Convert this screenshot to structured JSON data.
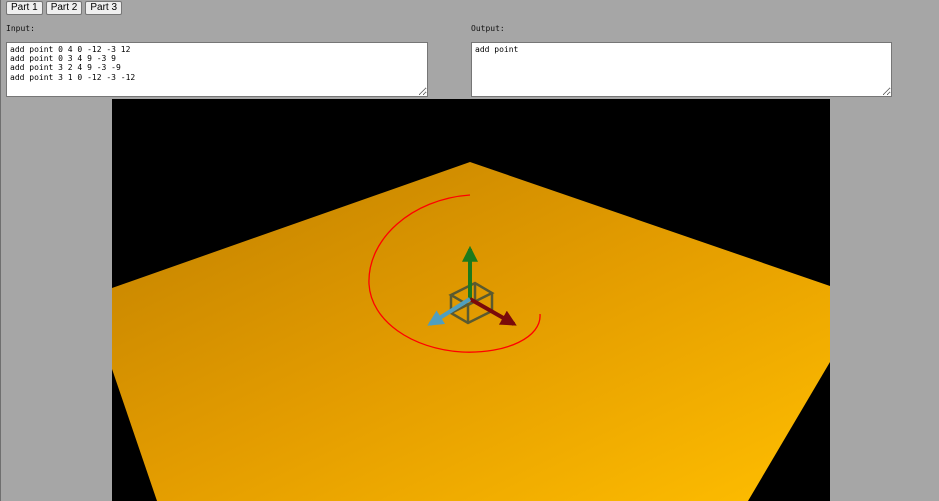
{
  "tabs": [
    "Part 1",
    "Part 2",
    "Part 3"
  ],
  "input": {
    "label": "Input:",
    "value": "add point 0 4 0 -12 -3 12\nadd point 0 3 4 9 -3 9\nadd point 3 2 4 9 -3 -9\nadd point 3 1 0 -12 -3 -12"
  },
  "output": {
    "label": "Output:",
    "value": "add point"
  },
  "scene": {
    "background": "#000000",
    "plane_colors": [
      "#c08000",
      "#e39c00",
      "#ffbe00"
    ],
    "spiral_color": "#ff0000",
    "axis_colors": {
      "x": "#7a0a0a",
      "y": "#1c7a1c",
      "z": "#4f9fbf"
    },
    "cube_color": "#5a5a30"
  }
}
